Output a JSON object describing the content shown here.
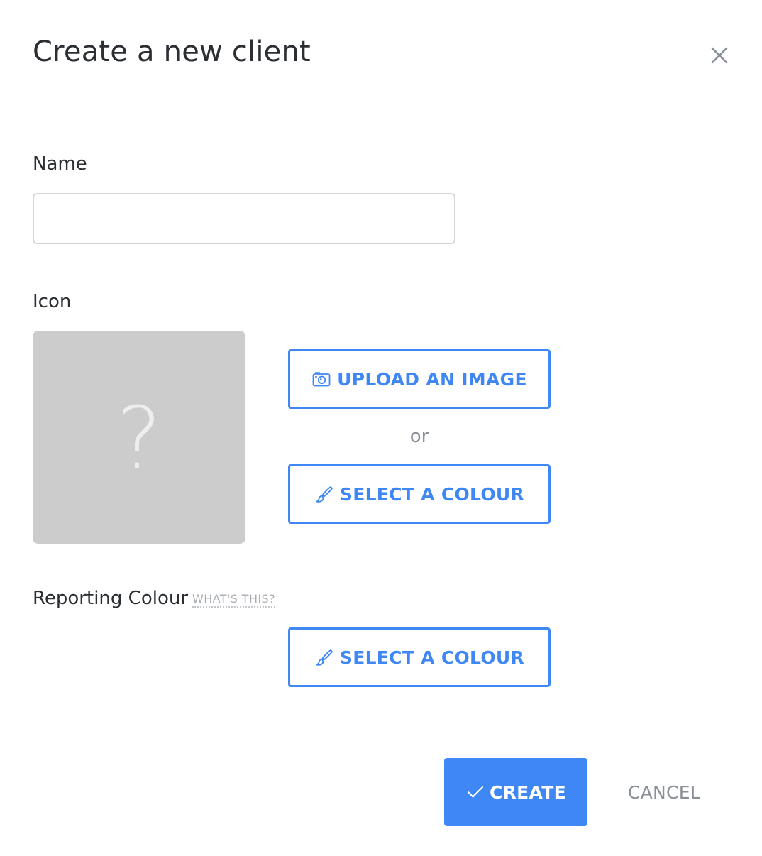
{
  "dialog": {
    "title": "Create a new client"
  },
  "name_field": {
    "label": "Name",
    "value": "",
    "placeholder": ""
  },
  "icon_section": {
    "label": "Icon",
    "placeholder_glyph": "?",
    "upload_label": "UPLOAD AN IMAGE",
    "or_text": "or",
    "select_colour_label": "SELECT A COLOUR"
  },
  "reporting_colour": {
    "label": "Reporting Colour",
    "help_link": "WHAT'S THIS?",
    "select_colour_label": "SELECT A COLOUR"
  },
  "footer": {
    "create_label": "CREATE",
    "cancel_label": "CANCEL"
  },
  "icons": {
    "close": "close-icon",
    "camera": "camera-icon",
    "brush": "brush-icon",
    "check": "check-icon"
  },
  "colors": {
    "accent": "#3e87f5",
    "preview_bg": "#cccccc",
    "muted_text": "#8a9098"
  }
}
